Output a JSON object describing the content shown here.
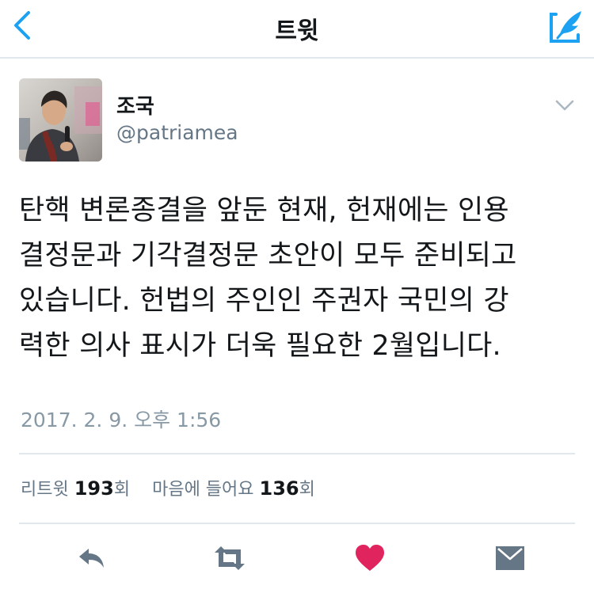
{
  "nav": {
    "title": "트윗",
    "back_icon": "chevron-left-icon",
    "compose_icon": "compose-tweet-icon",
    "accent_color": "#1da1f2"
  },
  "tweet": {
    "author": {
      "display_name": "조국",
      "handle": "@patriamea"
    },
    "lines": [
      "탄핵 변론종결을 앞둔 현재, 헌재에는 인용",
      "결정문과 기각결정문 초안이 모두 준비되고",
      "있습니다. 헌법의 주인인 주권자 국민의 강",
      "력한 의사 표시가 더욱 필요한 2월입니다."
    ],
    "timestamp": "2017. 2. 9. 오후 1:56",
    "stats": {
      "retweet_label": "리트윗",
      "retweet_count": "193",
      "retweet_unit": "회",
      "like_label": "마음에 들어요",
      "like_count": "136",
      "like_unit": "회"
    }
  },
  "actions": {
    "reply_icon": "reply-icon",
    "retweet_icon": "retweet-icon",
    "like_icon": "heart-icon",
    "like_color": "#e0245e",
    "message_icon": "direct-message-icon",
    "icon_color": "#657786"
  }
}
